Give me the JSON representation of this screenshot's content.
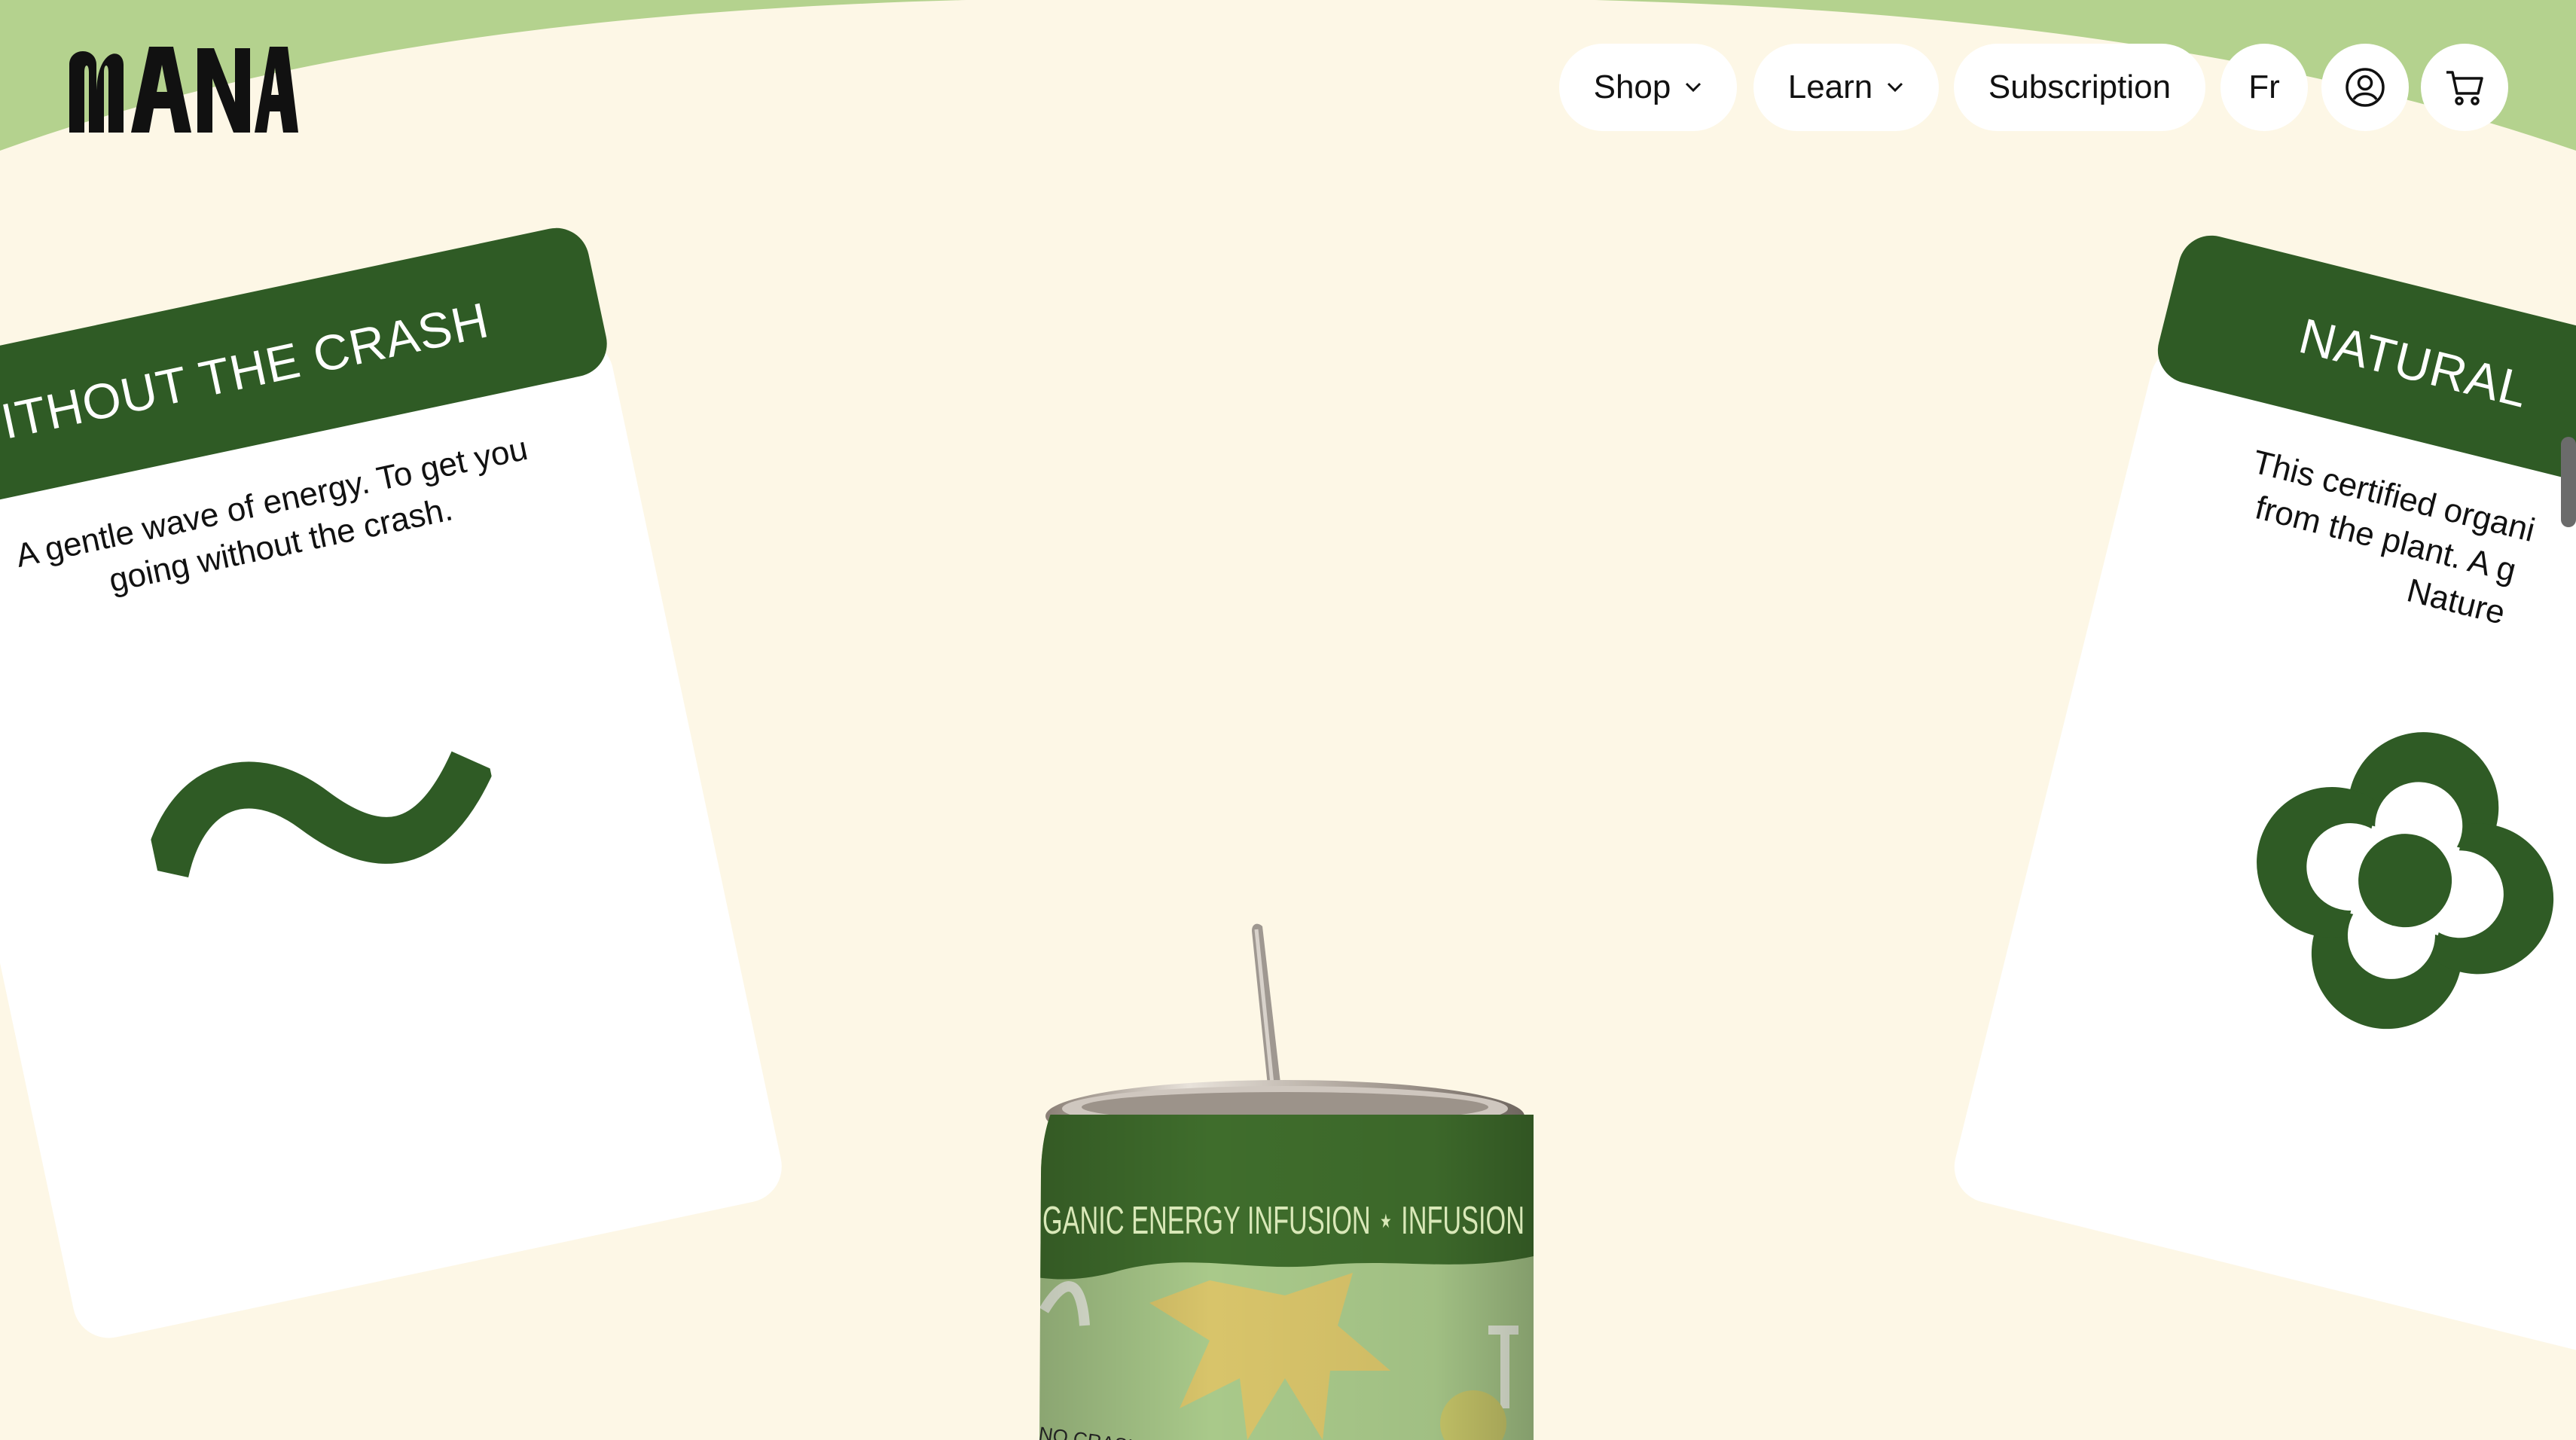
{
  "brand": {
    "logo_text": "MANA"
  },
  "nav": {
    "shop_label": "Shop",
    "learn_label": "Learn",
    "subscription_label": "Subscription",
    "language_label": "Fr"
  },
  "icons": {
    "account": "account-icon",
    "cart": "cart-icon",
    "chevron": "chevron-down-icon"
  },
  "cards": {
    "left": {
      "title": "WITHOUT THE CRASH",
      "body_line1": "A gentle wave of energy. To get you",
      "body_line2": "going without the crash.",
      "icon": "wave-icon"
    },
    "right": {
      "title": "NATURAL",
      "body_line1": "This certified organi",
      "body_line2": "from the plant. A g",
      "body_line3": "Nature",
      "icon": "flower-icon"
    }
  },
  "product": {
    "can_band_text": "GANIC ENERGY INFUSION ⋆ INFUSION",
    "can_side_text": "NO CRASH"
  },
  "colors": {
    "background": "#fdf7e6",
    "top_band": "#b4d28e",
    "brand_green": "#2f5b25",
    "can_light_green": "#a9c98a",
    "star_yellow": "#d8c46a"
  }
}
